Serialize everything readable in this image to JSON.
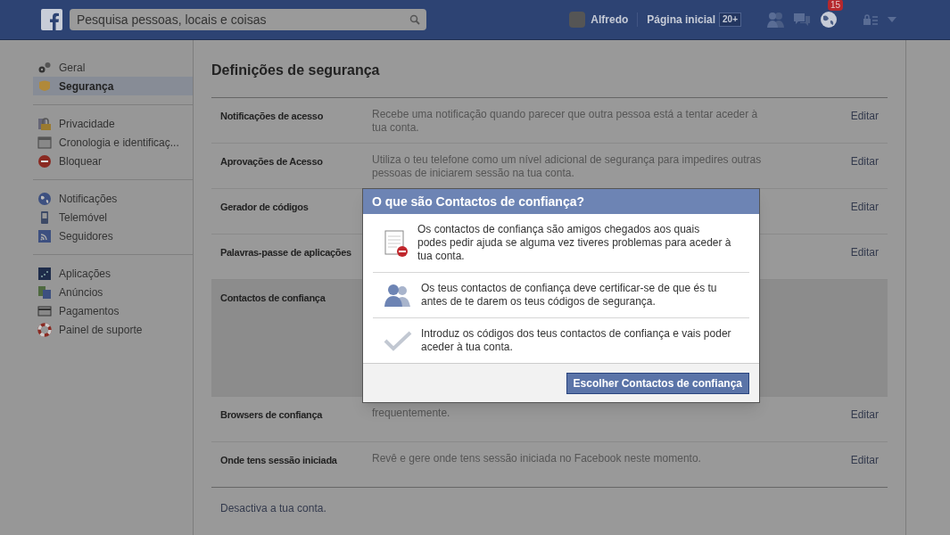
{
  "topbar": {
    "search": {
      "placeholder": "Pesquisa pessoas, locais e coisas"
    },
    "user": "Alfredo",
    "home": "Página inicial",
    "home_badge": "20+",
    "notifications_badge": "15"
  },
  "sidebar": {
    "groups": [
      {
        "items": [
          {
            "label": "Geral",
            "selected": false
          },
          {
            "label": "Segurança",
            "selected": true
          }
        ]
      },
      {
        "items": [
          {
            "label": "Privacidade",
            "selected": false
          },
          {
            "label": "Cronologia e identificaç...",
            "selected": false
          },
          {
            "label": "Bloquear",
            "selected": false
          }
        ]
      },
      {
        "items": [
          {
            "label": "Notificações",
            "selected": false
          },
          {
            "label": "Telemóvel",
            "selected": false
          },
          {
            "label": "Seguidores",
            "selected": false
          }
        ]
      },
      {
        "items": [
          {
            "label": "Aplicações",
            "selected": false
          },
          {
            "label": "Anúncios",
            "selected": false
          },
          {
            "label": "Pagamentos",
            "selected": false
          },
          {
            "label": "Painel de suporte",
            "selected": false
          }
        ]
      }
    ]
  },
  "main": {
    "title": "Definições de segurança",
    "rows": [
      {
        "label": "Notificações de acesso",
        "description": "Recebe uma notificação quando parecer que outra pessoa está a tentar aceder à tua conta.",
        "action": "Editar",
        "expanded": false
      },
      {
        "label": "Aprovações de Acesso",
        "description": "Utiliza o teu telefone como um nível adicional de segurança para impedires outras pessoas de iniciarem sessão na tua conta.",
        "action": "Editar",
        "expanded": false
      },
      {
        "label": "Gerador de códigos",
        "action": "Editar",
        "expanded": false
      },
      {
        "label": "Palavras-passe de aplicações",
        "action": "Editar",
        "expanded": false
      },
      {
        "label": "Contactos de confiança",
        "expanded": true
      },
      {
        "label": "Browsers de confiança",
        "description": "frequentemente.",
        "action": "Editar",
        "expanded": false
      },
      {
        "label": "Onde tens sessão iniciada",
        "description": "Revê e gere onde tens sessão iniciada no Facebook neste momento.",
        "action": "Editar",
        "expanded": false
      }
    ],
    "footer_link": "Desactiva a tua conta."
  },
  "dialog": {
    "title": "O que são Contactos de confiança?",
    "items": [
      {
        "text": "Os contactos de confiança são amigos chegados aos quais podes pedir ajuda se alguma vez tiveres problemas para aceder à tua conta."
      },
      {
        "text": "Os teus contactos de confiança deve certificar-se de que és tu antes de te darem os teus códigos de segurança."
      },
      {
        "text": "Introduz os códigos dos teus contactos de confiança e vais poder aceder à tua conta."
      }
    ],
    "button": "Escolher Contactos de confiança"
  }
}
